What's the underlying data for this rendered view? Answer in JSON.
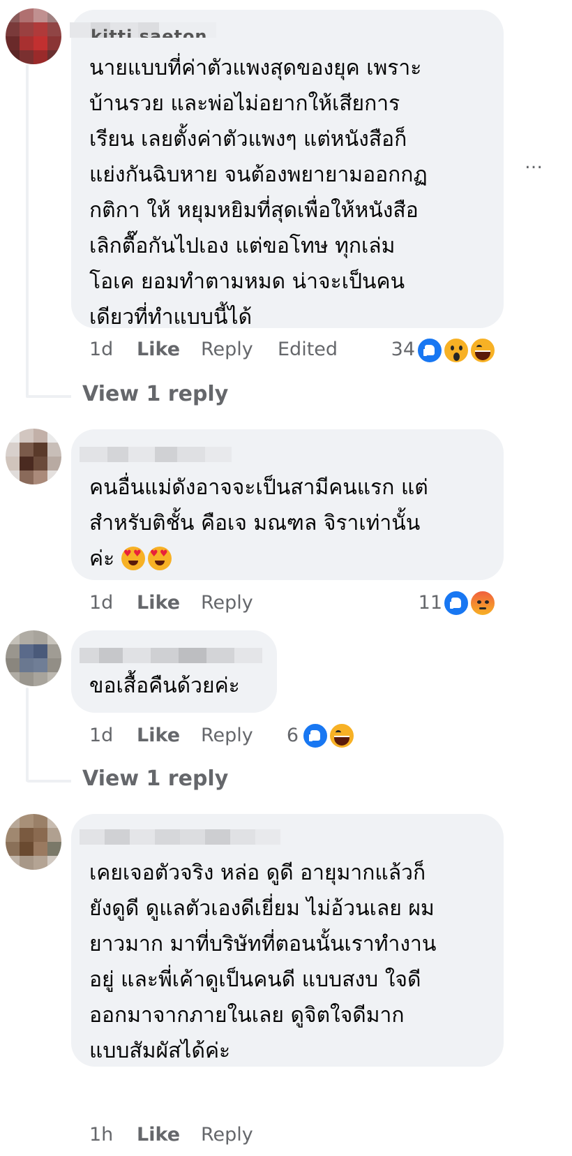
{
  "comments": [
    {
      "author": "kitti saeton",
      "text_lines": [
        "นายแบบที่ค่าตัวแพงสุดของยุค เพราะ",
        "บ้านรวย และพ่อไม่อยากให้เสียการ",
        "เรียน เลยตั้งค่าตัวแพงๆ แต่หนังสือก็",
        "แย่งกันฉิบหาย จนต้องพยายามออกกฏ",
        "กติกา ให้ หยุมหยิมที่สุดเพื่อให้หนังสือ",
        "เลิกตื๊อกันไปเอง แต่ขอโทษ ทุกเล่ม",
        "โอเค ยอมทำตามหมด น่าจะเป็นคน",
        "เดียวที่ทำแบบนี้ได้"
      ],
      "time": "1d",
      "like": "Like",
      "reply": "Reply",
      "edited": "Edited",
      "reaction_count": "34",
      "reactions": [
        "like-icon",
        "wow-icon",
        "haha-icon"
      ],
      "view_replies": "View 1 reply"
    },
    {
      "text_lines": [
        "คนอื่นแม่ดังอาจจะเป็นสามีคนแรก แต่",
        "สำหรับติชั้น คือเจ มณฑล จิราเท่านั้น",
        "ค่ะ"
      ],
      "time": "1d",
      "like": "Like",
      "reply": "Reply",
      "reaction_count": "11",
      "reactions": [
        "like-icon",
        "angry-icon"
      ]
    },
    {
      "text_lines": [
        "ขอเสื้อคืนด้วยค่ะ"
      ],
      "time": "1d",
      "like": "Like",
      "reply": "Reply",
      "reaction_count": "6",
      "reactions": [
        "like-icon",
        "haha-icon"
      ],
      "view_replies": "View 1 reply"
    },
    {
      "text_lines": [
        "เคยเจอตัวจริง หล่อ ดูดี อายุมากแล้วก็",
        "ยังดูดี ดูแลตัวเองดีเยี่ยม ไม่อ้วนเลย ผม",
        "ยาวมาก มาที่บริษัทที่ตอนนั้นเราทำงาน",
        "อยู่ และพี่เค้าดูเป็นคนดี แบบสงบ ใจดี",
        "ออกมาจากภายในเลย ดูจิตใจดีมาก",
        "แบบสัมผัสได้ค่ะ"
      ],
      "time": "1h",
      "like": "Like",
      "reply": "Reply"
    }
  ],
  "more_menu": "…",
  "colors": {
    "bubble": "#f0f2f5",
    "meta_text": "#65676b",
    "like_blue": "#1877f2",
    "emoji_yellow": "#f7b125"
  }
}
